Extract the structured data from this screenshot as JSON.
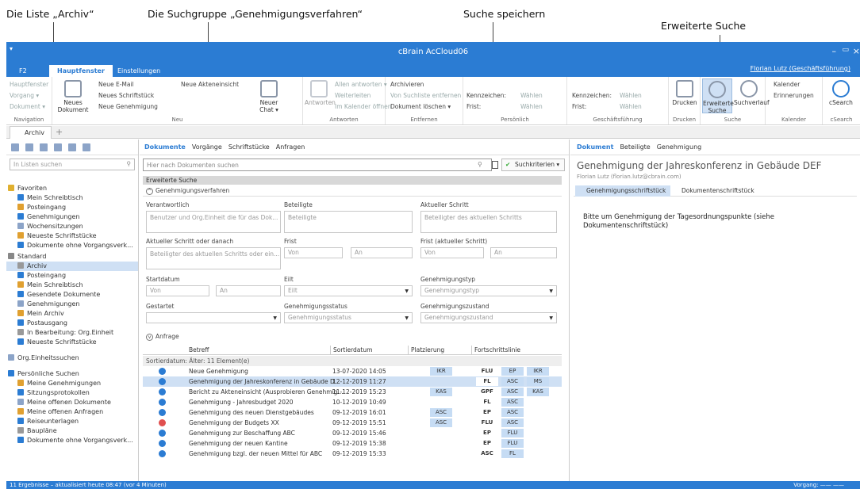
{
  "annotations": {
    "archiv": "Die Liste „Archiv“",
    "suchgruppe": "Die Suchgruppe „Genehmigungsverfahren“",
    "speichern": "Suche speichern",
    "erweitert": "Erweiterte Suche"
  },
  "window": {
    "title": "cBrain AcCloud06",
    "min": "–",
    "max": "▭",
    "close": "×"
  },
  "tabs": {
    "f2": "F2",
    "main": "Hauptfenster",
    "settings": "Einstellungen"
  },
  "user": "Florian Lutz (Geschäftsführung)",
  "ribbon": {
    "nav": {
      "items": [
        "Hauptfenster",
        "Vorgang ▾",
        "Dokument ▾"
      ],
      "label": "Navigation"
    },
    "neu": {
      "big": "Neues Dokument",
      "items": [
        "Neue E-Mail",
        "Neues Schriftstück",
        "Neue Genehmigung",
        "Neue Akteneinsicht"
      ],
      "chat": "Neuer Chat ▾",
      "label": "Neu"
    },
    "antworten": {
      "big": "Antworten",
      "items": [
        "Allen antworten ▾",
        "Weiterleiten",
        "Im Kalender öffnen"
      ],
      "label": "Antworten"
    },
    "entfernen": {
      "items": [
        "Archivieren",
        "Von Suchliste entfernen",
        "Dokument löschen ▾"
      ],
      "label": "Entfernen"
    },
    "persoenlich": {
      "k": "Kennzeichen:",
      "f": "Frist:",
      "w": "Wählen",
      "label": "Persönlich"
    },
    "gf": {
      "k": "Kennzeichen:",
      "f": "Frist:",
      "w": "Wählen",
      "label": "Geschäftsführung"
    },
    "drucken": {
      "big": "Drucken",
      "label": "Drucken"
    },
    "suche": {
      "erw": "Erweiterte Suche",
      "verlauf": "Suchverlauf",
      "label": "Suche"
    },
    "kalender": {
      "items": [
        "Kalender",
        "Erinnerungen"
      ],
      "label": "Kalender"
    },
    "csearch": {
      "big": "cSearch",
      "label": "cSearch"
    }
  },
  "doctab": "Archiv",
  "left": {
    "search": "In Listen suchen",
    "fav": "Favoriten",
    "favitems": [
      "Mein Schreibtisch",
      "Posteingang",
      "Genehmigungen",
      "Wochensitzungen",
      "Neueste Schriftstücke",
      "Dokumente ohne Vorgangsverk..."
    ],
    "std": "Standard",
    "stditems": [
      "Archiv",
      "Posteingang",
      "Mein Schreibtisch",
      "Gesendete Dokumente",
      "Genehmigungen",
      "Mein Archiv",
      "Postausgang",
      "In Bearbeitung: Org.Einheit",
      "Neueste Schriftstücke"
    ],
    "org": "Org.Einheitssuchen",
    "pers": "Persönliche Suchen",
    "persitems": [
      "Meine Genehmigungen",
      "Sitzungsprotokollen",
      "Meine offenen Dokumente",
      "Meine offenen Anfragen",
      "Reiseunterlagen",
      "Baupläne",
      "Dokumente ohne Vorgangsverk..."
    ]
  },
  "mid": {
    "tabs": [
      "Dokumente",
      "Vorgänge",
      "Schriftstücke",
      "Anfragen"
    ],
    "search": "Hier nach Dokumenten suchen",
    "crit": "Suchkriterien ▾",
    "erw": "Erweiterte Suche",
    "grp": "Genehmigungsverfahren",
    "f": {
      "verantw": "Verantwortlich",
      "verantw_ph": "Benutzer und Org.Einheit die für das Dok...",
      "beteiligte": "Beteiligte",
      "beteiligte_ph": "Beteiligte",
      "aks": "Aktueller Schritt",
      "aks_ph": "Beteiligter des aktuellen Schritts",
      "aksod": "Aktueller Schritt oder danach",
      "aksod_ph": "Beteiligter des aktuellen Schritts oder ein...",
      "frist": "Frist",
      "fak": "Frist (aktueller Schritt)",
      "von": "Von",
      "an": "An",
      "start": "Startdatum",
      "eilt": "Eilt",
      "eilt_ph": "Eilt",
      "gtyp": "Genehmigungstyp",
      "gtyp_ph": "Genehmigungstyp",
      "gest": "Gestartet",
      "gstat": "Genehmigungsstatus",
      "gstat_ph": "Genehmigungsstatus",
      "gz": "Genehmigungszustand",
      "gz_ph": "Genehmigungszustand"
    },
    "anfrage": "Anfrage",
    "cols": [
      "Betreff",
      "Sortierdatum",
      "Platzierung",
      "Fortschrittslinie"
    ],
    "group": "Sortierdatum: Älter: 11 Element(e)",
    "rows": [
      {
        "s": "Neue Genehmigung",
        "d": "13-07-2020 14:05",
        "p": "IKR",
        "f": [
          "FLU",
          "EP",
          "IKR"
        ]
      },
      {
        "s": "Genehmigung der Jahreskonferenz in Gebäude D...",
        "d": "12-12-2019 11:27",
        "p": "",
        "f": [
          "FL",
          "ASC",
          "MS"
        ]
      },
      {
        "s": "Bericht zu Akteneinsicht (Ausprobieren Genehmig...",
        "d": "11-12-2019 15:23",
        "p": "KAS",
        "f": [
          "GPF",
          "ASC",
          "KAS"
        ]
      },
      {
        "s": "Genehmigung - Jahresbudget 2020",
        "d": "10-12-2019 10:49",
        "p": "",
        "f": [
          "FL",
          "ASC",
          ""
        ]
      },
      {
        "s": "Genehmigung des neuen Dienstgebäudes",
        "d": "09-12-2019 16:01",
        "p": "ASC",
        "f": [
          "EP",
          "ASC",
          ""
        ]
      },
      {
        "s": "Genehmigung der Budgets XX",
        "d": "09-12-2019 15:51",
        "p": "ASC",
        "f": [
          "FLU",
          "ASC",
          ""
        ]
      },
      {
        "s": "Genehmigung zur Beschaffung ABC",
        "d": "09-12-2019 15:46",
        "p": "",
        "f": [
          "EP",
          "FLU",
          ""
        ]
      },
      {
        "s": "Genehmigung der neuen Kantine",
        "d": "09-12-2019 15:38",
        "p": "",
        "f": [
          "EP",
          "FLU",
          ""
        ]
      },
      {
        "s": "Genehmigung bzgl. der neuen Mittel für ABC",
        "d": "09-12-2019 15:33",
        "p": "",
        "f": [
          "ASC",
          "FL",
          ""
        ]
      }
    ]
  },
  "right": {
    "tabs": [
      "Dokument",
      "Beteiligte",
      "Genehmigung"
    ],
    "title": "Genehmigung der Jahreskonferenz in Gebäude DEF",
    "author": "Florian Lutz (florian.lutz@cbrain.com)",
    "t1": "Genehmigungsschriftstück",
    "t2": "Dokumentenschriftstück",
    "body": "Bitte um Genehmigung der Tagesordnungspunkte (siehe Dokumentenschriftstück)"
  },
  "status": "11 Ergebnisse – aktualisiert heute 08:47 (vor 4 Minuten)",
  "status_right": "Vorgang: ——  ——",
  "colors": {
    "accent": "#2b7cd3",
    "select": "#cfe0f4"
  }
}
